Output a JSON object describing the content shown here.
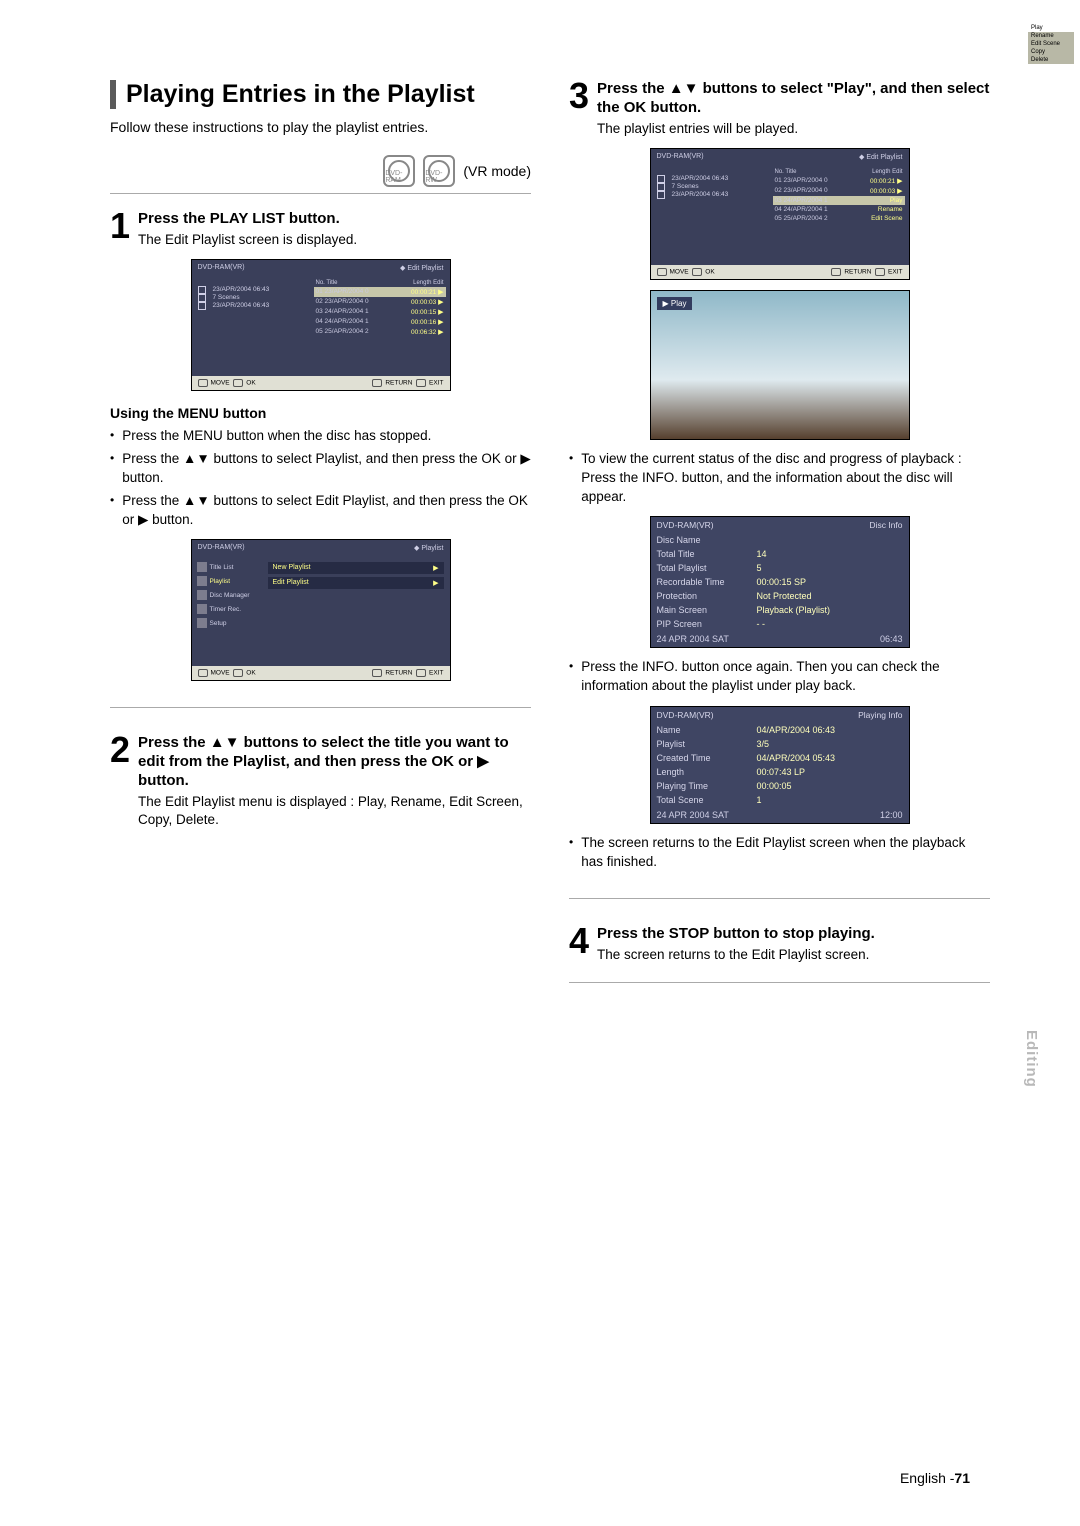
{
  "page": {
    "title": "Playing Entries in the Playlist",
    "intro": "Follow these instructions to play the playlist entries.",
    "vr_mode": "(VR mode)",
    "disc1": "DVD-RAM",
    "disc2": "DVD-RW",
    "footer_lang": "English -",
    "footer_page": "71",
    "side_tab": "Editing"
  },
  "step1": {
    "num": "1",
    "head": "Press the PLAY LIST button.",
    "desc": "The Edit Playlist screen is displayed.",
    "subhead": "Using the MENU button",
    "b1": "Press the MENU button when the disc has stopped.",
    "b2": "Press the ▲▼ buttons to select Playlist, and then press the OK or ▶ button.",
    "b3": "Press the ▲▼ buttons to select Edit Playlist, and then press the OK or ▶ button."
  },
  "step2": {
    "num": "2",
    "head": "Press the ▲▼ buttons to select the title you want to edit from the Playlist, and then press the OK or ▶ button.",
    "desc": "The Edit Playlist menu is displayed : Play, Rename, Edit Screen, Copy, Delete."
  },
  "step3": {
    "num": "3",
    "head": "Press the ▲▼ buttons to select \"Play\", and then select the OK button.",
    "desc": "The playlist entries will be played."
  },
  "step4": {
    "num": "4",
    "head": "Press the STOP button to stop playing.",
    "desc": "The screen returns to the Edit Playlist screen."
  },
  "right_bullets": {
    "b1": "To view the current status of the disc and progress of playback : Press the INFO. button, and the information about the disc will appear.",
    "b2": "Press the INFO. button once again. Then you can check the information about the playlist under play back.",
    "b3": "The screen returns to the Edit Playlist screen when the playback has finished."
  },
  "shot_common": {
    "device": "DVD-RAM(VR)",
    "edit_title": "Edit Playlist",
    "playlist_title": "Playlist",
    "date": "23/APR/2004 06:43",
    "scenes": "7 Scenes",
    "ft_move": "MOVE",
    "ft_ok": "OK",
    "ft_return": "RETURN",
    "ft_exit": "EXIT",
    "hdr_no": "No.",
    "hdr_title": "Title",
    "hdr_len": "Length",
    "hdr_edit": "Edit"
  },
  "shot_rows": [
    {
      "no": "01",
      "t": "23/APR/2004 0",
      "len": "00:00:21"
    },
    {
      "no": "02",
      "t": "23/APR/2004 0",
      "len": "00:00:03"
    },
    {
      "no": "03",
      "t": "24/APR/2004 1",
      "len": "00:00:15"
    },
    {
      "no": "04",
      "t": "24/APR/2004 1",
      "len": "00:00:16"
    },
    {
      "no": "05",
      "t": "25/APR/2004 2",
      "len": "00:06:32"
    }
  ],
  "popup": {
    "play": "Play",
    "rename": "Rename",
    "editscene": "Edit Scene",
    "copy": "Copy",
    "delete": "Delete"
  },
  "menu_shot": {
    "titlelist": "Title List",
    "playlist": "Playlist",
    "discmgr": "Disc Manager",
    "timerrec": "Timer Rec.",
    "setup": "Setup",
    "newpl": "New Playlist",
    "editpl": "Edit Playlist"
  },
  "play_overlay": "▶ Play",
  "disc_info": {
    "corner": "Disc Info",
    "name_k": "Disc Name",
    "name_v": "",
    "tt_k": "Total Title",
    "tt_v": "14",
    "tp_k": "Total Playlist",
    "tp_v": "5",
    "rt_k": "Recordable Time",
    "rt_v": "00:00:15 SP",
    "pr_k": "Protection",
    "pr_v": "Not Protected",
    "ms_k": "Main Screen",
    "ms_v": "Playback (Playlist)",
    "ps_k": "PIP Screen",
    "ps_v": "- -",
    "ftl_d": "24 APR 2004 SAT",
    "ftl_t": "06:43"
  },
  "play_info": {
    "corner": "Playing Info",
    "name_k": "Name",
    "name_v": "04/APR/2004 06:43",
    "pl_k": "Playlist",
    "pl_v": "3/5",
    "ct_k": "Created Time",
    "ct_v": "04/APR/2004 05:43",
    "ln_k": "Length",
    "ln_v": "00:07:43 LP",
    "pt_k": "Playing Time",
    "pt_v": "00:00:05",
    "ts_k": "Total Scene",
    "ts_v": "1",
    "ftl_d": "24 APR 2004 SAT",
    "ftl_t": "12:00"
  }
}
